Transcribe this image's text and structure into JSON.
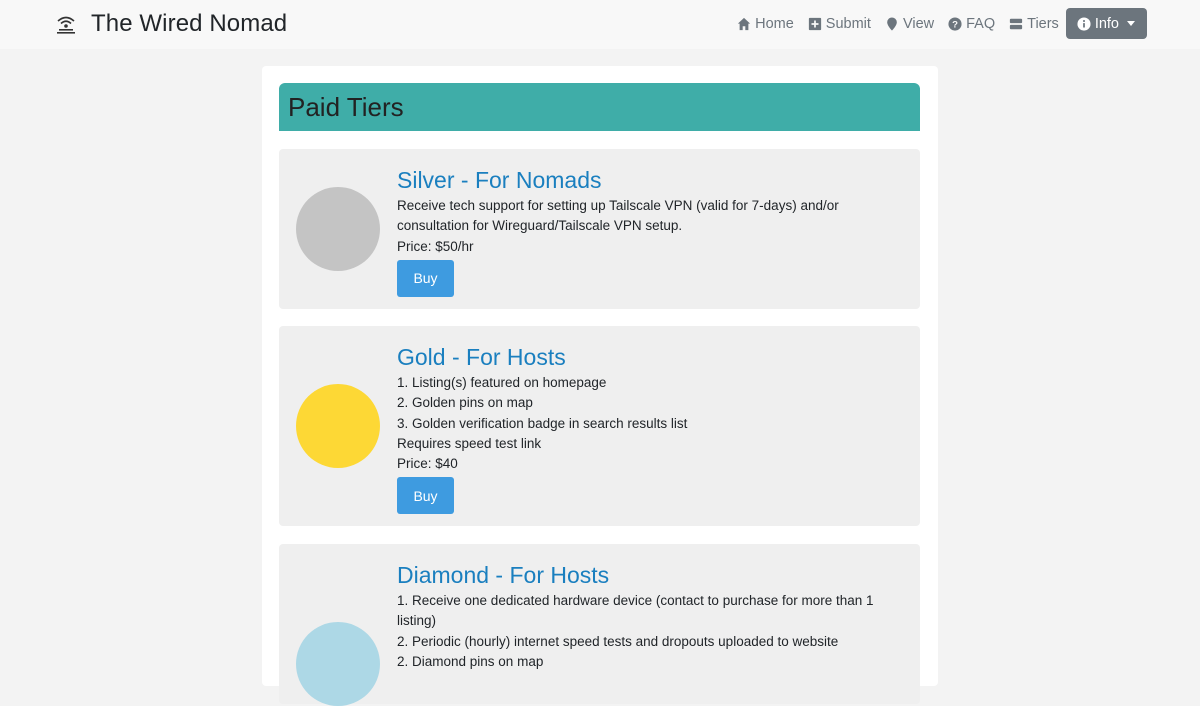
{
  "app": {
    "title": "The Wired Nomad"
  },
  "nav": {
    "items": [
      {
        "label": "Home",
        "icon": "home-icon"
      },
      {
        "label": "Submit",
        "icon": "plus-square-icon"
      },
      {
        "label": "View",
        "icon": "map-marker-icon"
      },
      {
        "label": "FAQ",
        "icon": "question-circle-icon"
      },
      {
        "label": "Tiers",
        "icon": "server-icon"
      }
    ],
    "info_label": "Info"
  },
  "page": {
    "title": "Paid Tiers"
  },
  "tiers": [
    {
      "title": "Silver - For Nomads",
      "color": "#c4c4c4",
      "lines": [
        "Receive tech support for setting up Tailscale VPN (valid for 7-days) and/or consultation for Wireguard/Tailscale VPN setup.",
        "Price: $50/hr"
      ],
      "button": "Buy"
    },
    {
      "title": "Gold - For Hosts",
      "color": "#fdd835",
      "lines": [
        "1. Listing(s) featured on homepage",
        "2. Golden pins on map",
        "3. Golden verification badge in search results list",
        "Requires speed test link",
        "Price: $40"
      ],
      "button": "Buy"
    },
    {
      "title": "Diamond - For Hosts",
      "color": "#add8e6",
      "lines": [
        "1. Receive one dedicated hardware device (contact to purchase for more than 1 listing)",
        "2. Periodic (hourly) internet speed tests and dropouts uploaded to website",
        "2. Diamond pins on map"
      ]
    }
  ]
}
